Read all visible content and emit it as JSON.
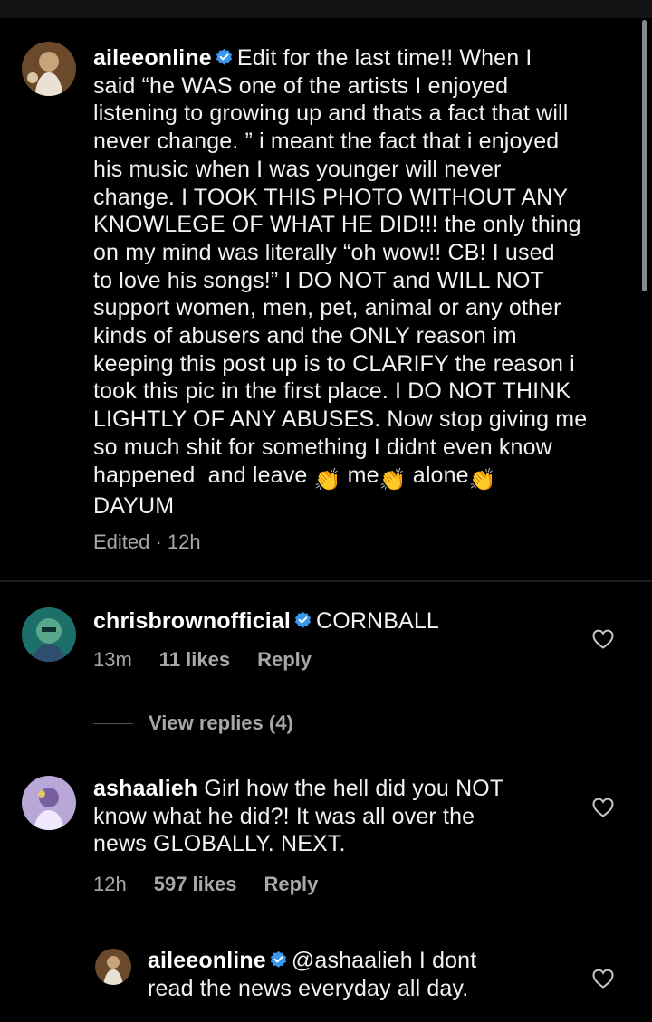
{
  "post_caption": {
    "username": "aileeonline",
    "lines": [
      "Edit for the last time!! When I",
      "said “he WAS one of the artists I enjoyed",
      "listening to growing up and thats a fact that will",
      "never change. ” i meant the fact that i enjoyed",
      "his music when I was younger will never",
      "change. I TOOK THIS PHOTO WITHOUT ANY",
      "KNOWLEGE OF WHAT HE DID!!! the only thing",
      "on my mind was literally “oh wow!! CB! I used",
      "to love his songs!” I DO NOT and WILL NOT",
      "support women, men, pet, animal or any other",
      "kinds of abusers and the ONLY reason im",
      "keeping this post up is to CLARIFY the reason i",
      "took this pic in the first place. I DO NOT THINK",
      "LIGHTLY OF ANY ABUSES. Now stop giving me",
      "so much shit for something I didnt even know"
    ],
    "line16_a": "happened  and leave",
    "line16_b": "me",
    "line16_c": "alone",
    "last_line": "DAYUM",
    "meta": "Edited · 12h"
  },
  "comments": [
    {
      "username": "chrisbrownofficial",
      "text": "CORNBALL",
      "time": "13m",
      "likes": "11 likes",
      "reply": "Reply"
    },
    {
      "username": "ashaalieh",
      "lines": [
        "Girl how the hell did you NOT",
        "know what he did?! It was all over the",
        "news GLOBALLY. NEXT."
      ],
      "time": "12h",
      "likes": "597 likes",
      "reply": "Reply"
    }
  ],
  "view_replies": "View replies (4)",
  "reply_comment": {
    "username": "aileeonline",
    "lines": [
      "@ashaalieh I dont",
      "read the news everyday all day."
    ]
  },
  "colors": {
    "verified_badge": "#3897f0",
    "muted_text": "#a8a8a8",
    "background": "#000000"
  }
}
